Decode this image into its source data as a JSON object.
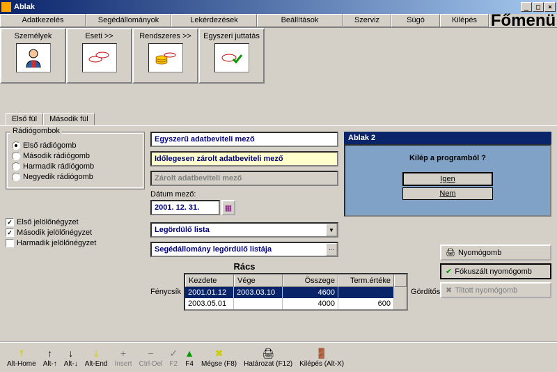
{
  "window": {
    "title": "Ablak",
    "main_title": "Főmenü"
  },
  "titlebar_buttons": {
    "min": "_",
    "max": "□",
    "close": "×"
  },
  "menubar": {
    "adatkezeles": "Adatkezelés",
    "segedallomanyok": "Segédállományok",
    "lekerdezesek": "Lekérdezések",
    "beallitasok": "Beállítások",
    "szerviz": "Szerviz",
    "sugo": "Súgó",
    "kilepes": "Kilépés"
  },
  "toolbar": {
    "szemelyek": "Személyek",
    "eseti": "Eseti >>",
    "rendszeres": "Rendszeres >>",
    "egyszeri": "Egyszeri juttatás"
  },
  "tabs": {
    "first": "Első fül",
    "second": "Második fül"
  },
  "radiogroup": {
    "title": "Rádiógombok",
    "r1": "Első rádiógomb",
    "r2": "Második rádiógomb",
    "r3": "Harmadik rádiógomb",
    "r4": "Negyedik rádiógomb",
    "selected": "r1"
  },
  "checkboxes": {
    "c1": "Első jelölőnégyzet",
    "c2": "Második jelölőnégyzet",
    "c3": "Harmadik jelölőnégyzet",
    "c1_checked": true,
    "c2_checked": true,
    "c3_checked": false
  },
  "fields": {
    "simple": "Egyszerű adatbeviteli mező",
    "templock": "Időlegesen zárolt adatbeviteli mező",
    "locked": "Zárolt adatbeviteli mező",
    "date_label": "Dátum mező:",
    "date_value": "2001. 12. 31.",
    "combo1": "Legördülő lista",
    "combo2": "Segédállomány legördülő listája"
  },
  "dialog": {
    "title": "Ablak 2",
    "question": "Kilép a programból ?",
    "yes": "Igen",
    "no": "Nem"
  },
  "grid": {
    "title": "Rács",
    "row_label": "Fénycsík",
    "scroll_label": "Gördítősáv",
    "headers": {
      "h1": "Kezdete",
      "h2": "Vége",
      "h3": "Összege",
      "h4": "Term.értéke"
    },
    "rows": [
      {
        "start": "2001.01.12",
        "end": "2003.03.10",
        "sum": "4600",
        "val": ""
      },
      {
        "start": "2003.05.01",
        "end": "",
        "sum": "4000",
        "val": "600"
      }
    ]
  },
  "buttons": {
    "push": "Nyomógomb",
    "focused": "Fókuszált nyomógomb",
    "disabled": "Tiltott nyomógomb"
  },
  "bottombar": {
    "althome": "Alt-Home",
    "altup": "Alt-↑",
    "altdown": "Alt-↓",
    "altend": "Alt-End",
    "insert": "Insert",
    "ctrldel": "Ctrl-Del",
    "f2": "F2",
    "f4": "F4",
    "megse": "Mégse (F8)",
    "hatarozat": "Határozat (F12)",
    "kilepes": "Kilépés (Alt-X)"
  }
}
